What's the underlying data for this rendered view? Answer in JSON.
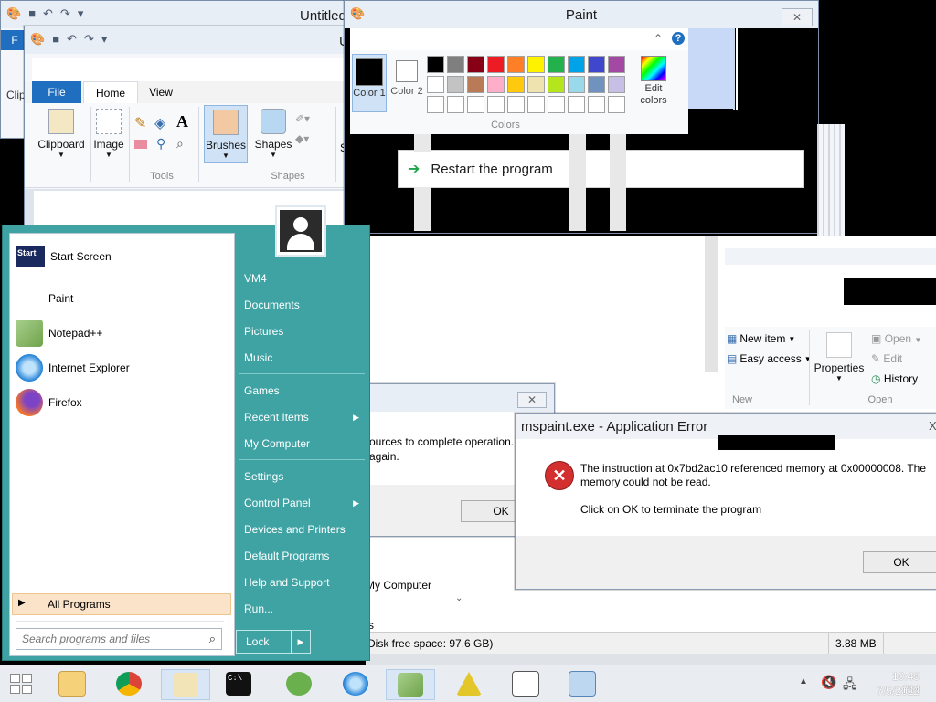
{
  "back_window": {
    "title": "Untitled",
    "file_tab_fragment": "F",
    "clip_fragment": "Clip"
  },
  "paint_window": {
    "title": "Untitled",
    "title_fragment": "U",
    "tabs": {
      "file": "File",
      "home": "Home",
      "view": "View"
    },
    "groups": {
      "clipboard": "Clipboard",
      "image": "Image",
      "tools": "Tools",
      "brushes": "Brushes",
      "shapes": "Shapes",
      "shapes_group": "Shapes",
      "size_fragment": "S"
    },
    "text_tool": "A"
  },
  "paint_small_window": {
    "title": "Paint",
    "close_glyph": "✕",
    "colors_group": "Colors",
    "color1": "Color 1",
    "color2": "Color 2",
    "edit_colors": "Edit colors",
    "help_glyph": "?",
    "restart": "Restart the program",
    "palette": [
      "#000000",
      "#7f7f7f",
      "#880015",
      "#ed1c24",
      "#ff7f27",
      "#fff200",
      "#22b14c",
      "#00a2e8",
      "#3f48cc",
      "#a349a4",
      "#ffffff",
      "#c3c3c3",
      "#b97a57",
      "#ffaec9",
      "#ffc90e",
      "#efe4b0",
      "#b5e61d",
      "#99d9ea",
      "#7092be",
      "#c8bfe7"
    ]
  },
  "explorer_window": {
    "new_item": "New item",
    "easy_access": "Easy access",
    "properties": "Properties",
    "open": "Open",
    "edit": "Edit",
    "history": "History",
    "group_new": "New",
    "group_open": "Open",
    "my_computer": "My Computer",
    "status_free": "Disk free space: 97.6 GB)",
    "status_size": "3.88 MB",
    "status_prefix": "s"
  },
  "dialog_behind": {
    "text_line1": "ources to complete operation.",
    "text_line2": "again.",
    "ok": "OK",
    "close_glyph": "✕"
  },
  "error_dialog": {
    "title": "mspaint.exe - Application Error",
    "message_line1": "The instruction at 0x7bd2ac10 referenced memory at 0x00000008. The",
    "message_line2": "memory could not be read.",
    "message_line3": "Click on OK to terminate the program",
    "ok": "OK",
    "close_fragment": "X"
  },
  "start_menu": {
    "left_items": [
      {
        "label": "Start Screen",
        "icon": "start-screen-icon"
      },
      {
        "label": "Paint",
        "icon": "paint-icon"
      },
      {
        "label": "Notepad++",
        "icon": "notepadpp-icon"
      },
      {
        "label": "Internet Explorer",
        "icon": "ie-icon"
      },
      {
        "label": "Firefox",
        "icon": "firefox-icon"
      }
    ],
    "start_tile": "Start",
    "all_programs": "All Programs",
    "search_placeholder": "Search programs and files",
    "right_items": [
      "VM4",
      "Documents",
      "Pictures",
      "Music",
      "Games",
      "Recent Items",
      "My Computer",
      "Settings",
      "Control Panel",
      "Devices and Printers",
      "Default Programs",
      "Help and Support",
      "Run..."
    ],
    "lock": "Lock",
    "submenu_arrow": "▶"
  },
  "taskbar": {
    "time": "10:45 PM",
    "date": "7/5/2022",
    "cmd_glyph": "C:\\"
  },
  "colors": {
    "accent": "#1f6ec0",
    "start_menu_bg": "#3fa3a4",
    "error_red": "#d32f2f"
  }
}
